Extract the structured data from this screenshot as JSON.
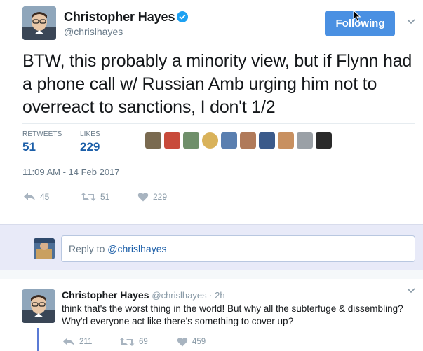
{
  "tweet": {
    "author_name": "Christopher Hayes",
    "author_handle": "@chrislhayes",
    "follow_label": "Following",
    "text": "BTW, this probably a minority view, but if Flynn had a phone call w/ Russian Amb urging him not to overreact to sanctions, I don't 1/2",
    "retweets_label": "RETWEETS",
    "retweets_value": "51",
    "likes_label": "LIKES",
    "likes_value": "229",
    "timestamp": "11:09 AM - 14 Feb 2017",
    "actions": {
      "reply_count": "45",
      "retweet_count": "51",
      "like_count": "229"
    }
  },
  "reply_box": {
    "prefix": "Reply to ",
    "mention": "@chrislhayes"
  },
  "reply": {
    "author_name": "Christopher Hayes",
    "meta": "@chrislhayes · 2h",
    "text": "think that's the worst thing in the world! But why all the subterfuge & dissembling? Why'd everyone act like there's something to cover up?",
    "actions": {
      "reply_count": "211",
      "retweet_count": "69",
      "like_count": "459"
    }
  },
  "colors": {
    "follow_button": "#4a90e2",
    "stat_value": "#1b5ea8",
    "muted": "#657786",
    "reply_area_bg": "#e8eaf8",
    "thread_line": "#5b7bd5"
  },
  "likers": [
    "#7a6a50",
    "#c84a3a",
    "#6f8f6a",
    "#d9b25a",
    "#5a7fb0",
    "#b07a5a",
    "#3b5a8a",
    "#c89060",
    "#9aa0a6",
    "#2a2a2a"
  ]
}
